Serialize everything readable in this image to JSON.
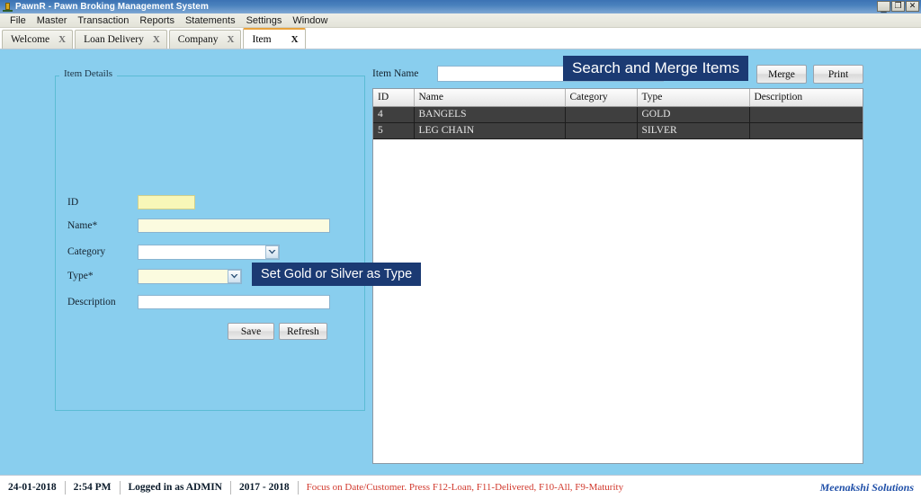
{
  "window": {
    "title": "PawnR - Pawn Broking Management System",
    "icon": "app-icon",
    "controls": {
      "minimize": "_",
      "restore": "❐",
      "close": "✕"
    }
  },
  "menubar": {
    "items": [
      "File",
      "Master",
      "Transaction",
      "Reports",
      "Statements",
      "Settings",
      "Window"
    ]
  },
  "tabs": [
    {
      "label": "Welcome",
      "close": "X",
      "active": false
    },
    {
      "label": "Loan Delivery",
      "close": "X",
      "active": false
    },
    {
      "label": "Company",
      "close": "X",
      "active": false
    },
    {
      "label": "Item",
      "close": "X",
      "active": true
    }
  ],
  "item_details": {
    "title": "Item Details",
    "fields": {
      "id": {
        "label": "ID",
        "value": "",
        "placeholder": ""
      },
      "name": {
        "label": "Name*",
        "value": "",
        "placeholder": ""
      },
      "category": {
        "label": "Category",
        "value": "",
        "placeholder": ""
      },
      "type": {
        "label": "Type*",
        "value": "",
        "placeholder": ""
      },
      "description": {
        "label": "Description",
        "value": "",
        "placeholder": ""
      }
    },
    "buttons": {
      "save": "Save",
      "refresh": "Refresh"
    }
  },
  "search_panel": {
    "label": "Item Name",
    "value": "",
    "placeholder": "",
    "buttons": {
      "merge": "Merge",
      "print": "Print"
    }
  },
  "grid": {
    "columns": [
      "ID",
      "Name",
      "Category",
      "Type",
      "Description"
    ],
    "rows": [
      {
        "id": "4",
        "name": "BANGELS",
        "category": "",
        "type": "GOLD",
        "description": ""
      },
      {
        "id": "5",
        "name": "LEG CHAIN",
        "category": "",
        "type": "SILVER",
        "description": ""
      }
    ]
  },
  "callouts": {
    "search_merge": "Search and Merge Items",
    "set_type": "Set Gold or Silver as Type"
  },
  "statusbar": {
    "date": "24-01-2018",
    "time": "2:54 PM",
    "login": "Logged in as  ADMIN",
    "year": "2017  -  2018",
    "hint": "Focus on Date/Customer. Press F12-Loan, F11-Delivered, F10-All, F9-Maturity",
    "brand": "Meenakshi Solutions"
  },
  "colors": {
    "titlebar": "#4a81bd",
    "workspace": "#89ceee",
    "callout": "#1b3a73",
    "grid_row": "#3f3f3f",
    "required_field": "#fbfbdf",
    "id_field": "#f8f7b8",
    "hint_text": "#d1392d",
    "brand_text": "#1f4fa8",
    "active_tab_accent": "#e8a33d"
  }
}
